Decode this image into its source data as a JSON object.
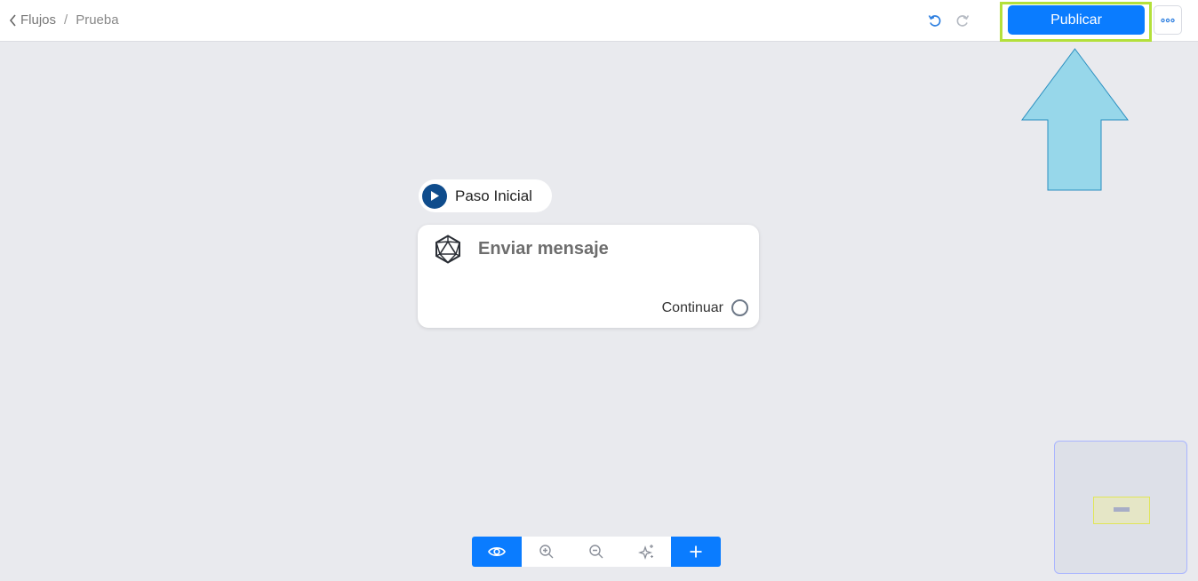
{
  "header": {
    "breadcrumb_back": "Flujos",
    "breadcrumb_separator": "/",
    "breadcrumb_current": "Prueba",
    "publish_label": "Publicar"
  },
  "canvas": {
    "start_label": "Paso Inicial",
    "node": {
      "title": "Enviar mensaje",
      "output_label": "Continuar"
    }
  },
  "toolbar": {
    "icons": [
      "eye-icon",
      "zoom-in-icon",
      "zoom-out-icon",
      "sparkles-icon",
      "plus-icon"
    ]
  },
  "colors": {
    "accent": "#0a7cff",
    "highlight": "#b4e03a",
    "arrow": "#97d7ea",
    "canvas": "#e9eaee",
    "start_icon": "#0f4c8c"
  }
}
